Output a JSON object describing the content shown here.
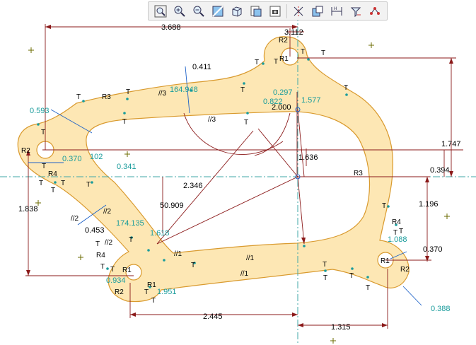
{
  "toolbar": {
    "buttons": [
      {
        "id": "zoom-fit",
        "icon": "zoom-fit-icon"
      },
      {
        "id": "zoom-in",
        "icon": "zoom-in-icon"
      },
      {
        "id": "zoom-out",
        "icon": "zoom-out-icon"
      },
      {
        "id": "repaint",
        "icon": "repaint-icon"
      },
      {
        "id": "display-style",
        "icon": "display-style-icon"
      },
      {
        "id": "saved-views",
        "icon": "saved-views-icon"
      },
      {
        "id": "view-manager",
        "icon": "view-manager-icon"
      },
      {
        "id": "datum-display",
        "icon": "datum-display-icon"
      },
      {
        "id": "sketch-orient",
        "icon": "sketch-orientation-icon"
      },
      {
        "id": "dims-display",
        "icon": "dimension-display-icon"
      },
      {
        "id": "constraints-display",
        "icon": "constraint-display-icon"
      },
      {
        "id": "vertex-display",
        "icon": "vertex-display-icon"
      }
    ]
  },
  "colors": {
    "fill": "#fde7b4",
    "outline": "#d99a2e",
    "dim_line": "#8b1a1a",
    "centerline": "#3fa7a7",
    "text_teal": "#1a9c9c",
    "weak_dim": "#1e62c8"
  },
  "dimensions": {
    "d3688": "3.688",
    "d3112": "3.112",
    "d0411": "0.411",
    "d164948": "164.948",
    "d0297": "0.297",
    "d0822": "0.822",
    "d1577": "1.577",
    "d2000": "2.000",
    "d1747": "1.747",
    "d0593": "0.593",
    "d0370a": "0.370",
    "d0102": "102",
    "d0341": "0.341",
    "d1636": "1.636",
    "d0394": "0.394",
    "d2346": "2.346",
    "d50909": "50.909",
    "d1196": "1.196",
    "d1838": "1.838",
    "d0453": "0.453",
    "d174135": "174.135",
    "d1618": "1.618",
    "d1088": "1.088",
    "d0370b": "0.370",
    "d0934": "0.934",
    "d1951": "1.951",
    "d0388": "0.388",
    "d2445": "2.445",
    "d1315": "1.315"
  },
  "labels": {
    "T": "T",
    "R1": "R1",
    "R2": "R2",
    "R3": "R3",
    "R4": "R4",
    "p1": "//1",
    "p2": "//2",
    "p3": "//3"
  }
}
